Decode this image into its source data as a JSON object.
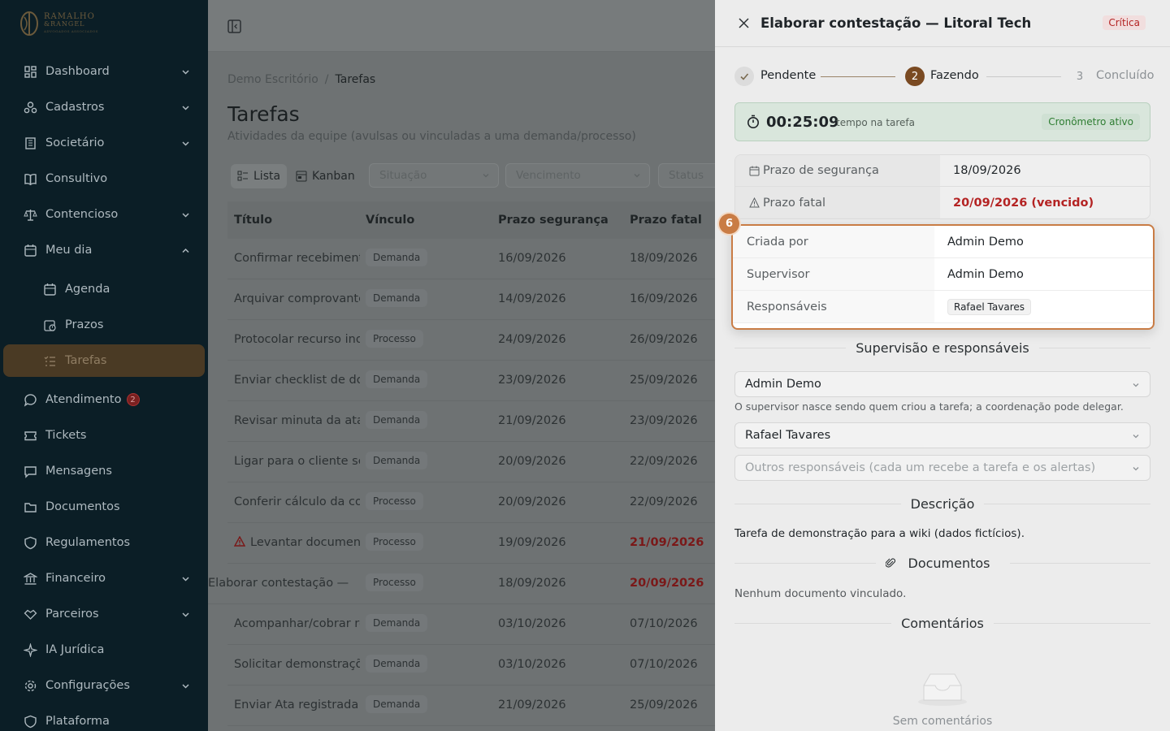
{
  "brand": {
    "line1": "RAMALHO",
    "line2": "&RANGEL",
    "line3": "ADVOGADOS ASSOCIADOS"
  },
  "sidebar": {
    "items": [
      {
        "label": "Dashboard",
        "icon": "dashboard-icon",
        "chevron": "down"
      },
      {
        "label": "Cadastros",
        "icon": "users-icon",
        "chevron": "down"
      },
      {
        "label": "Societário",
        "icon": "building-icon",
        "chevron": "down"
      },
      {
        "label": "Consultivo",
        "icon": "book-icon"
      },
      {
        "label": "Contencioso",
        "icon": "scale-icon",
        "chevron": "down"
      },
      {
        "label": "Meu dia",
        "icon": "calendar-icon",
        "chevron": "up"
      },
      {
        "label": "Agenda",
        "icon": "calendar-icon",
        "sub": true
      },
      {
        "label": "Prazos",
        "icon": "clock-calendar-icon",
        "sub": true
      },
      {
        "label": "Tarefas",
        "icon": "task-list-icon",
        "sub": true,
        "active": true
      },
      {
        "label": "Atendimento",
        "icon": "chat-icon",
        "badge": "2"
      },
      {
        "label": "Tickets",
        "icon": "ticket-icon"
      },
      {
        "label": "Mensagens",
        "icon": "message-icon"
      },
      {
        "label": "Documentos",
        "icon": "folder-icon"
      },
      {
        "label": "Regulamentos",
        "icon": "shield-icon"
      },
      {
        "label": "Financeiro",
        "icon": "bank-icon",
        "chevron": "down"
      },
      {
        "label": "Parceiros",
        "icon": "handshake-icon",
        "chevron": "down"
      },
      {
        "label": "IA Jurídica",
        "icon": "sparkle-icon"
      },
      {
        "label": "Configurações",
        "icon": "gear-icon",
        "chevron": "down"
      },
      {
        "label": "Plataforma",
        "icon": "shield-icon"
      }
    ]
  },
  "main": {
    "breadcrumb": {
      "root": "Demo Escritório",
      "sep": "/",
      "current": "Tarefas"
    },
    "title": "Tarefas",
    "subtitle": "Atividades da equipe (avulsas ou vinculadas a uma demanda/processo)",
    "views": {
      "list": "Lista",
      "kanban": "Kanban"
    },
    "filters": {
      "situacao": "Situação",
      "vencimento": "Vencimento",
      "status": "Status"
    },
    "columns": {
      "titulo": "Título",
      "vinculo": "Vínculo",
      "prazo_seguranca": "Prazo segurança",
      "prazo_fatal": "Prazo fatal"
    },
    "rows": [
      {
        "titulo": "Confirmar recebimento",
        "vinculo": "Demanda",
        "ps": "16/09/2026",
        "pf": "18/09/2026"
      },
      {
        "titulo": "Arquivar comprovante",
        "vinculo": "Demanda",
        "ps": "14/09/2026",
        "pf": "16/09/2026"
      },
      {
        "titulo": "Protocolar recurso ino",
        "vinculo": "Processo",
        "ps": "24/09/2026",
        "pf": "26/09/2026"
      },
      {
        "titulo": "Enviar checklist de do",
        "vinculo": "Demanda",
        "ps": "23/09/2026",
        "pf": "25/09/2026"
      },
      {
        "titulo": "Revisar minuta da ata",
        "vinculo": "Demanda",
        "ps": "21/09/2026",
        "pf": "23/09/2026"
      },
      {
        "titulo": "Ligar para o cliente sc",
        "vinculo": "Demanda",
        "ps": "20/09/2026",
        "pf": "22/09/2026"
      },
      {
        "titulo": "Conferir cálculo da co",
        "vinculo": "Processo",
        "ps": "20/09/2026",
        "pf": "22/09/2026"
      },
      {
        "titulo": "Levantar document",
        "vinculo": "Processo",
        "ps": "19/09/2026",
        "pf": "21/09/2026",
        "warn": true,
        "pf_red": true
      },
      {
        "titulo": "Elaborar contestação —",
        "vinculo": "Processo",
        "ps": "18/09/2026",
        "pf": "20/09/2026",
        "pf_red": true,
        "selected": true
      },
      {
        "titulo": "Acompanhar/cobrar re",
        "vinculo": "Demanda",
        "ps": "03/10/2026",
        "pf": "07/10/2026"
      },
      {
        "titulo": "Solicitar demonstraçõ",
        "vinculo": "Demanda",
        "ps": "03/10/2026",
        "pf": "07/10/2026"
      },
      {
        "titulo": "Enviar Ata registrada a",
        "vinculo": "Demanda",
        "ps": "21/09/2026",
        "pf": "25/09/2026"
      }
    ]
  },
  "drawer": {
    "title": "Elaborar contestação — Litoral Tech",
    "priority": "Crítica",
    "steps": [
      {
        "num": "1",
        "label": "Pendente",
        "state": "done"
      },
      {
        "num": "2",
        "label": "Fazendo",
        "state": "current"
      },
      {
        "num": "3",
        "label": "Concluído",
        "state": "todo"
      }
    ],
    "timer": {
      "value": "00:25:09",
      "label": "tempo na tarefa",
      "status": "Cronômetro ativo"
    },
    "deadlines": {
      "seguranca_label": "Prazo de segurança",
      "seguranca_value": "18/09/2026",
      "fatal_label": "Prazo fatal",
      "fatal_value": "20/09/2026 (vencido)"
    },
    "highlight_number": "6",
    "people": {
      "criada_label": "Criada por",
      "criada_value": "Admin Demo",
      "supervisor_label": "Supervisor",
      "supervisor_value": "Admin Demo",
      "resp_label": "Responsáveis",
      "resp_value": "Rafael Tavares"
    },
    "supervision": {
      "heading": "Supervisão e responsáveis",
      "supervisor_select": "Admin Demo",
      "hint": "O supervisor nasce sendo quem criou a tarefa; a coordenação pode delegar.",
      "responsible_select": "Rafael Tavares",
      "others_placeholder": "Outros responsáveis (cada um recebe a tarefa e os alertas)"
    },
    "description": {
      "heading": "Descrição",
      "text": "Tarefa de demonstração para a wiki (dados fictícios)."
    },
    "documents": {
      "heading": "Documentos",
      "empty": "Nenhum documento vinculado."
    },
    "comments": {
      "heading": "Comentários",
      "empty": "Sem comentários"
    }
  },
  "colors": {
    "accent": "#c97c45",
    "danger": "#b42323",
    "success": "#2e7d32",
    "sidebar_bg": "#0b1e26"
  }
}
